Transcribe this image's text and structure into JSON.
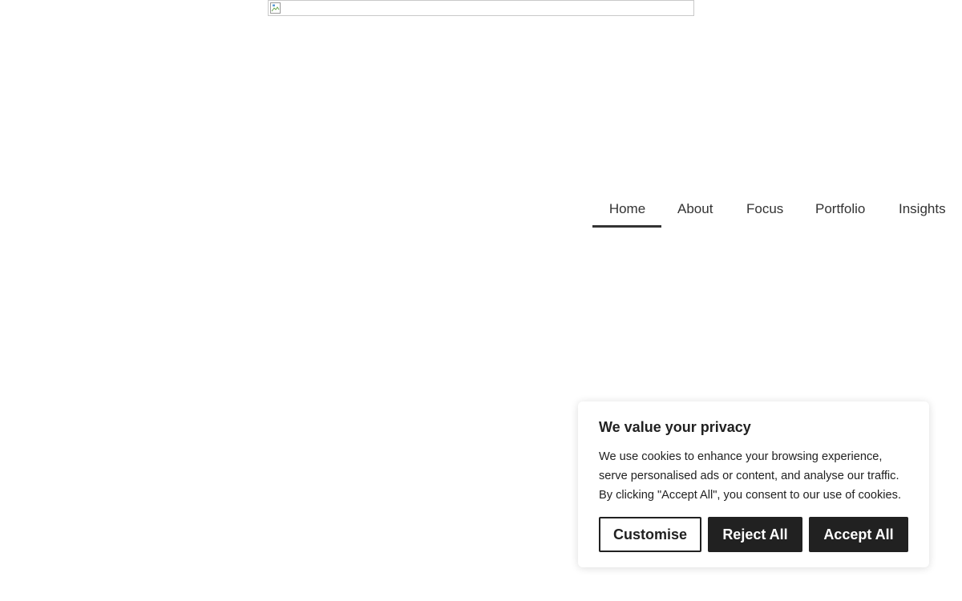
{
  "header": {
    "logo_icon": "broken-image-icon"
  },
  "nav": {
    "items": [
      {
        "label": "Home",
        "active": true
      },
      {
        "label": "About",
        "active": false
      },
      {
        "label": "Focus",
        "active": false
      },
      {
        "label": "Portfolio",
        "active": false
      },
      {
        "label": "Insights",
        "active": false
      }
    ],
    "active_underline_color": "#333333"
  },
  "cookie_banner": {
    "title": "We value your privacy",
    "text": "We use cookies to enhance your browsing experience, serve personalised ads or content, and analyse our traffic. By clicking \"Accept All\", you consent to our use of cookies.",
    "customise_label": "Customise",
    "reject_label": "Reject All",
    "accept_label": "Accept All",
    "button_color": "#212121"
  }
}
